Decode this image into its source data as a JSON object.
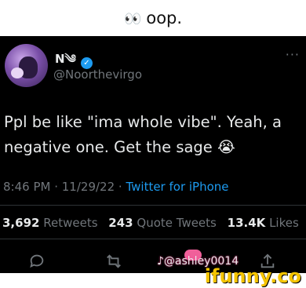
{
  "caption": {
    "emoji": "👀",
    "text": "oop."
  },
  "tweet": {
    "display_name": "N༄",
    "verified_mark": "✓",
    "handle": "@Noorthevirgo",
    "more": "···",
    "text": "Ppl be like \"ima whole vibe\". Yeah, a negative one. Get the sage 😭",
    "time": "8:46 PM",
    "date": "11/29/22",
    "source": "Twitter for iPhone",
    "separator": " · "
  },
  "stats": {
    "retweets_count": "3,692",
    "retweets_label": "Retweets",
    "quotes_count": "243",
    "quotes_label": "Quote Tweets",
    "likes_count": "13.4K",
    "likes_label": "Likes"
  },
  "actions": {
    "reply_icon": "speech-bubble-icon",
    "retweet_icon": "retweet-icon",
    "like_icon": "heart-icon",
    "share_icon": "share-icon"
  },
  "overlay": {
    "tiktok_user": "♪@ashley0014",
    "site_watermark": "ifunny.co"
  },
  "colors": {
    "background": "#000000",
    "text": "#e7e9ea",
    "muted": "#71767b",
    "accent": "#1d9bf0",
    "ifunny": "#f5c400"
  }
}
